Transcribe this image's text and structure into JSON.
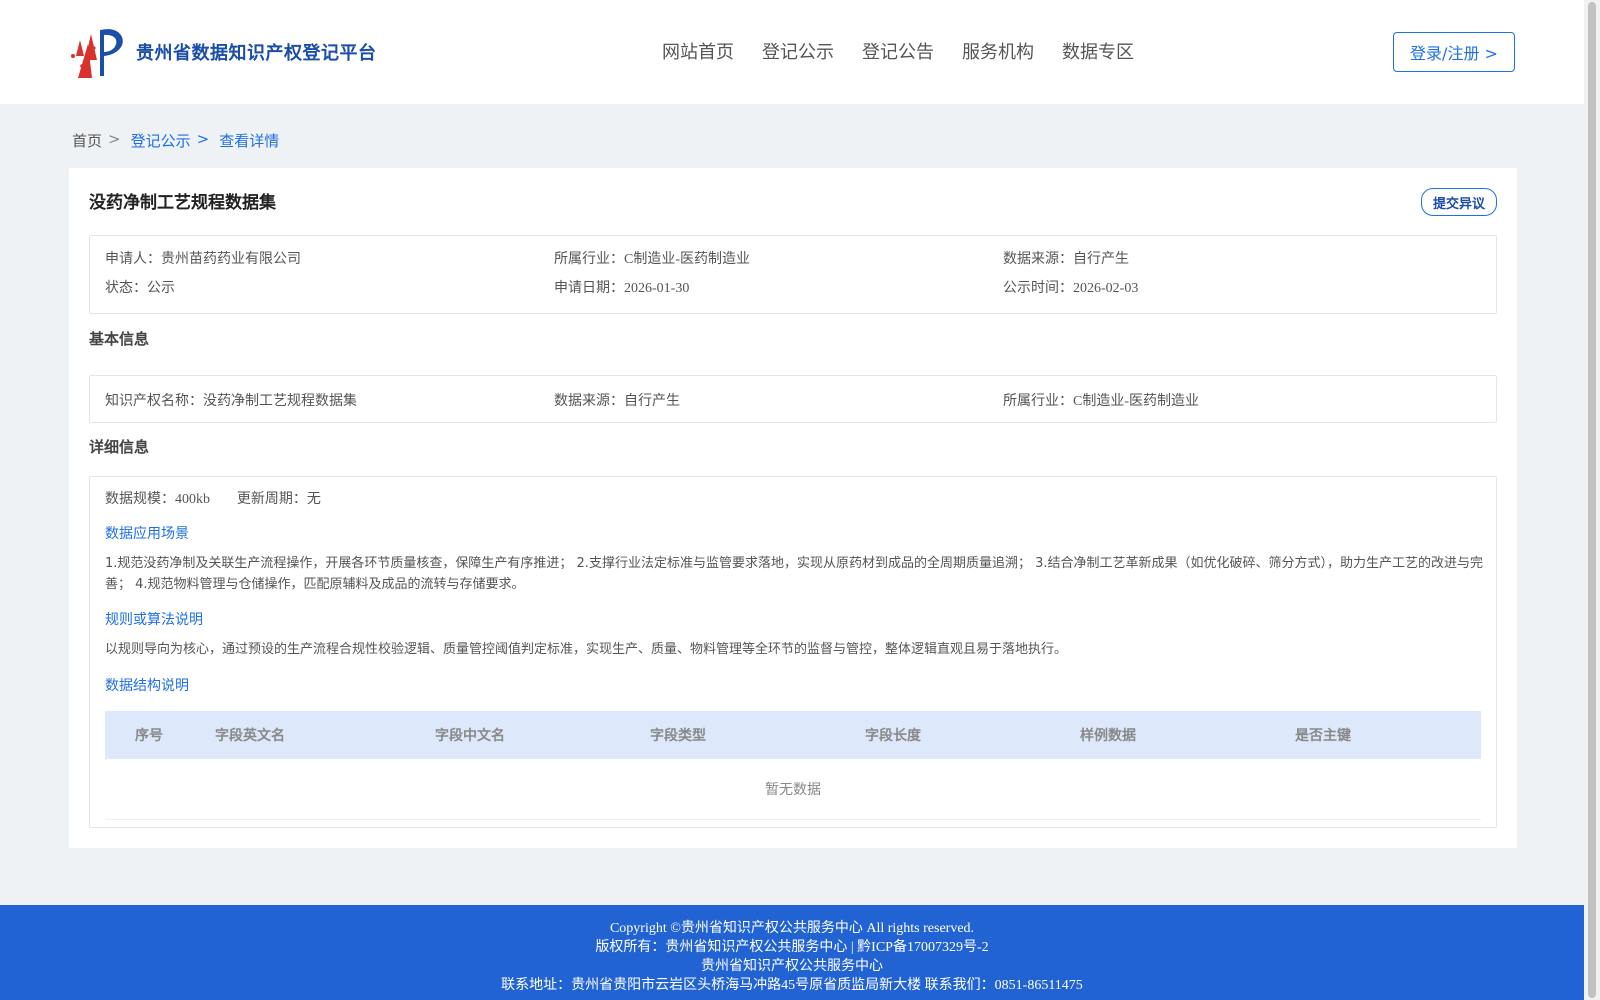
{
  "header": {
    "logo_text": "贵州省数据知识产权登记平台",
    "nav": [
      "网站首页",
      "登记公示",
      "登记公告",
      "服务机构",
      "数据专区"
    ],
    "login_label": "登录/注册 >"
  },
  "breadcrumb": {
    "home": "首页",
    "sep": ">",
    "level1": "登记公示",
    "current": "查看详情"
  },
  "detail": {
    "title": "没药净制工艺规程数据集",
    "objection_label": "提交异议",
    "summary": {
      "applicant_label": "申请人：",
      "applicant": "贵州苗药药业有限公司",
      "industry_label": "所属行业：",
      "industry": "C制造业-医药制造业",
      "source_label": "数据来源：",
      "source": "自行产生",
      "status_label": "状态：",
      "status": "公示",
      "apply_date_label": "申请日期：",
      "apply_date": "2026-01-30",
      "publish_date_label": "公示时间：",
      "publish_date": "2026-02-03"
    },
    "basic_title": "基本信息",
    "basic": {
      "ip_name_label": "知识产权名称：",
      "ip_name": "没药净制工艺规程数据集",
      "source_label": "数据来源：",
      "source": "自行产生",
      "industry_label": "所属行业：",
      "industry": "C制造业-医药制造业"
    },
    "detail_title": "详细信息",
    "scale_label": "数据规模：",
    "scale": "400kb",
    "cycle_label": "更新周期：",
    "cycle": "无",
    "scenario_title": "数据应用场景",
    "scenario_text": "1.规范没药净制及关联生产流程操作，开展各环节质量核查，保障生产有序推进； 2.支撑行业法定标准与监管要求落地，实现从原药材到成品的全周期质量追溯； 3.结合净制工艺革新成果（如优化破碎、筛分方式），助力生产工艺的改进与完善； 4.规范物料管理与仓储操作，匹配原辅料及成品的流转与存储要求。",
    "rule_title": "规则或算法说明",
    "rule_text": "以规则导向为核心，通过预设的生产流程合规性校验逻辑、质量管控阈值判定标准，实现生产、质量、物料管理等全环节的监督与管控，整体逻辑直观且易于落地执行。",
    "structure_title": "数据结构说明",
    "table_headers": [
      "序号",
      "字段英文名",
      "字段中文名",
      "字段类型",
      "字段长度",
      "样例数据",
      "是否主键"
    ],
    "table_empty": "暂无数据"
  },
  "footer": {
    "line1": "Copyright ©贵州省知识产权公共服务中心 All rights reserved.",
    "line2": "版权所有：贵州省知识产权公共服务中心 | 黔ICP备17007329号-2",
    "line3": "贵州省知识产权公共服务中心",
    "line4": "联系地址：贵州省贵阳市云岩区头桥海马冲路45号原省质监局新大楼 联系我们：0851-86511475"
  },
  "colors": {
    "primary": "#1f6fe5",
    "brand": "#1b4ea8",
    "footer": "#2263d4",
    "table_head": "#dde9fb"
  }
}
